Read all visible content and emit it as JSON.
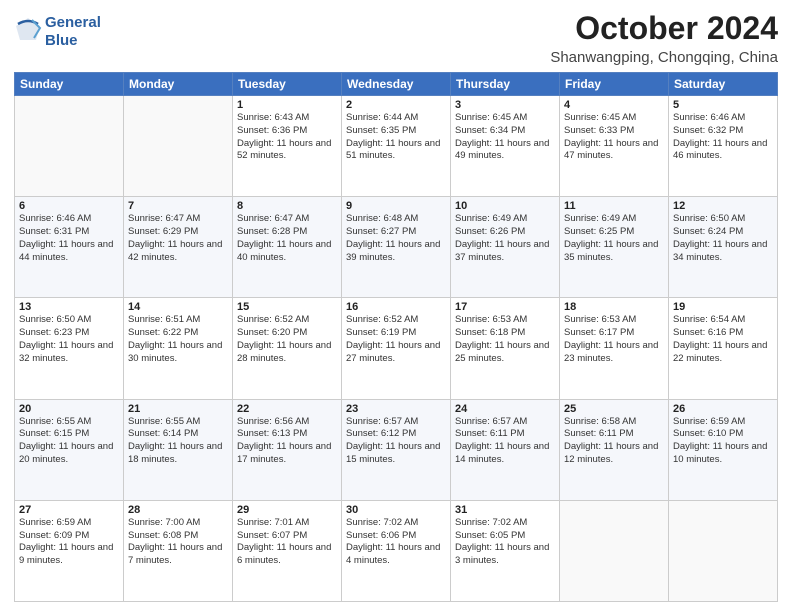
{
  "header": {
    "logo_line1": "General",
    "logo_line2": "Blue",
    "title": "October 2024",
    "subtitle": "Shanwangping, Chongqing, China"
  },
  "weekdays": [
    "Sunday",
    "Monday",
    "Tuesday",
    "Wednesday",
    "Thursday",
    "Friday",
    "Saturday"
  ],
  "weeks": [
    [
      {
        "day": "",
        "detail": ""
      },
      {
        "day": "",
        "detail": ""
      },
      {
        "day": "1",
        "detail": "Sunrise: 6:43 AM\nSunset: 6:36 PM\nDaylight: 11 hours and 52 minutes."
      },
      {
        "day": "2",
        "detail": "Sunrise: 6:44 AM\nSunset: 6:35 PM\nDaylight: 11 hours and 51 minutes."
      },
      {
        "day": "3",
        "detail": "Sunrise: 6:45 AM\nSunset: 6:34 PM\nDaylight: 11 hours and 49 minutes."
      },
      {
        "day": "4",
        "detail": "Sunrise: 6:45 AM\nSunset: 6:33 PM\nDaylight: 11 hours and 47 minutes."
      },
      {
        "day": "5",
        "detail": "Sunrise: 6:46 AM\nSunset: 6:32 PM\nDaylight: 11 hours and 46 minutes."
      }
    ],
    [
      {
        "day": "6",
        "detail": "Sunrise: 6:46 AM\nSunset: 6:31 PM\nDaylight: 11 hours and 44 minutes."
      },
      {
        "day": "7",
        "detail": "Sunrise: 6:47 AM\nSunset: 6:29 PM\nDaylight: 11 hours and 42 minutes."
      },
      {
        "day": "8",
        "detail": "Sunrise: 6:47 AM\nSunset: 6:28 PM\nDaylight: 11 hours and 40 minutes."
      },
      {
        "day": "9",
        "detail": "Sunrise: 6:48 AM\nSunset: 6:27 PM\nDaylight: 11 hours and 39 minutes."
      },
      {
        "day": "10",
        "detail": "Sunrise: 6:49 AM\nSunset: 6:26 PM\nDaylight: 11 hours and 37 minutes."
      },
      {
        "day": "11",
        "detail": "Sunrise: 6:49 AM\nSunset: 6:25 PM\nDaylight: 11 hours and 35 minutes."
      },
      {
        "day": "12",
        "detail": "Sunrise: 6:50 AM\nSunset: 6:24 PM\nDaylight: 11 hours and 34 minutes."
      }
    ],
    [
      {
        "day": "13",
        "detail": "Sunrise: 6:50 AM\nSunset: 6:23 PM\nDaylight: 11 hours and 32 minutes."
      },
      {
        "day": "14",
        "detail": "Sunrise: 6:51 AM\nSunset: 6:22 PM\nDaylight: 11 hours and 30 minutes."
      },
      {
        "day": "15",
        "detail": "Sunrise: 6:52 AM\nSunset: 6:20 PM\nDaylight: 11 hours and 28 minutes."
      },
      {
        "day": "16",
        "detail": "Sunrise: 6:52 AM\nSunset: 6:19 PM\nDaylight: 11 hours and 27 minutes."
      },
      {
        "day": "17",
        "detail": "Sunrise: 6:53 AM\nSunset: 6:18 PM\nDaylight: 11 hours and 25 minutes."
      },
      {
        "day": "18",
        "detail": "Sunrise: 6:53 AM\nSunset: 6:17 PM\nDaylight: 11 hours and 23 minutes."
      },
      {
        "day": "19",
        "detail": "Sunrise: 6:54 AM\nSunset: 6:16 PM\nDaylight: 11 hours and 22 minutes."
      }
    ],
    [
      {
        "day": "20",
        "detail": "Sunrise: 6:55 AM\nSunset: 6:15 PM\nDaylight: 11 hours and 20 minutes."
      },
      {
        "day": "21",
        "detail": "Sunrise: 6:55 AM\nSunset: 6:14 PM\nDaylight: 11 hours and 18 minutes."
      },
      {
        "day": "22",
        "detail": "Sunrise: 6:56 AM\nSunset: 6:13 PM\nDaylight: 11 hours and 17 minutes."
      },
      {
        "day": "23",
        "detail": "Sunrise: 6:57 AM\nSunset: 6:12 PM\nDaylight: 11 hours and 15 minutes."
      },
      {
        "day": "24",
        "detail": "Sunrise: 6:57 AM\nSunset: 6:11 PM\nDaylight: 11 hours and 14 minutes."
      },
      {
        "day": "25",
        "detail": "Sunrise: 6:58 AM\nSunset: 6:11 PM\nDaylight: 11 hours and 12 minutes."
      },
      {
        "day": "26",
        "detail": "Sunrise: 6:59 AM\nSunset: 6:10 PM\nDaylight: 11 hours and 10 minutes."
      }
    ],
    [
      {
        "day": "27",
        "detail": "Sunrise: 6:59 AM\nSunset: 6:09 PM\nDaylight: 11 hours and 9 minutes."
      },
      {
        "day": "28",
        "detail": "Sunrise: 7:00 AM\nSunset: 6:08 PM\nDaylight: 11 hours and 7 minutes."
      },
      {
        "day": "29",
        "detail": "Sunrise: 7:01 AM\nSunset: 6:07 PM\nDaylight: 11 hours and 6 minutes."
      },
      {
        "day": "30",
        "detail": "Sunrise: 7:02 AM\nSunset: 6:06 PM\nDaylight: 11 hours and 4 minutes."
      },
      {
        "day": "31",
        "detail": "Sunrise: 7:02 AM\nSunset: 6:05 PM\nDaylight: 11 hours and 3 minutes."
      },
      {
        "day": "",
        "detail": ""
      },
      {
        "day": "",
        "detail": ""
      }
    ]
  ]
}
